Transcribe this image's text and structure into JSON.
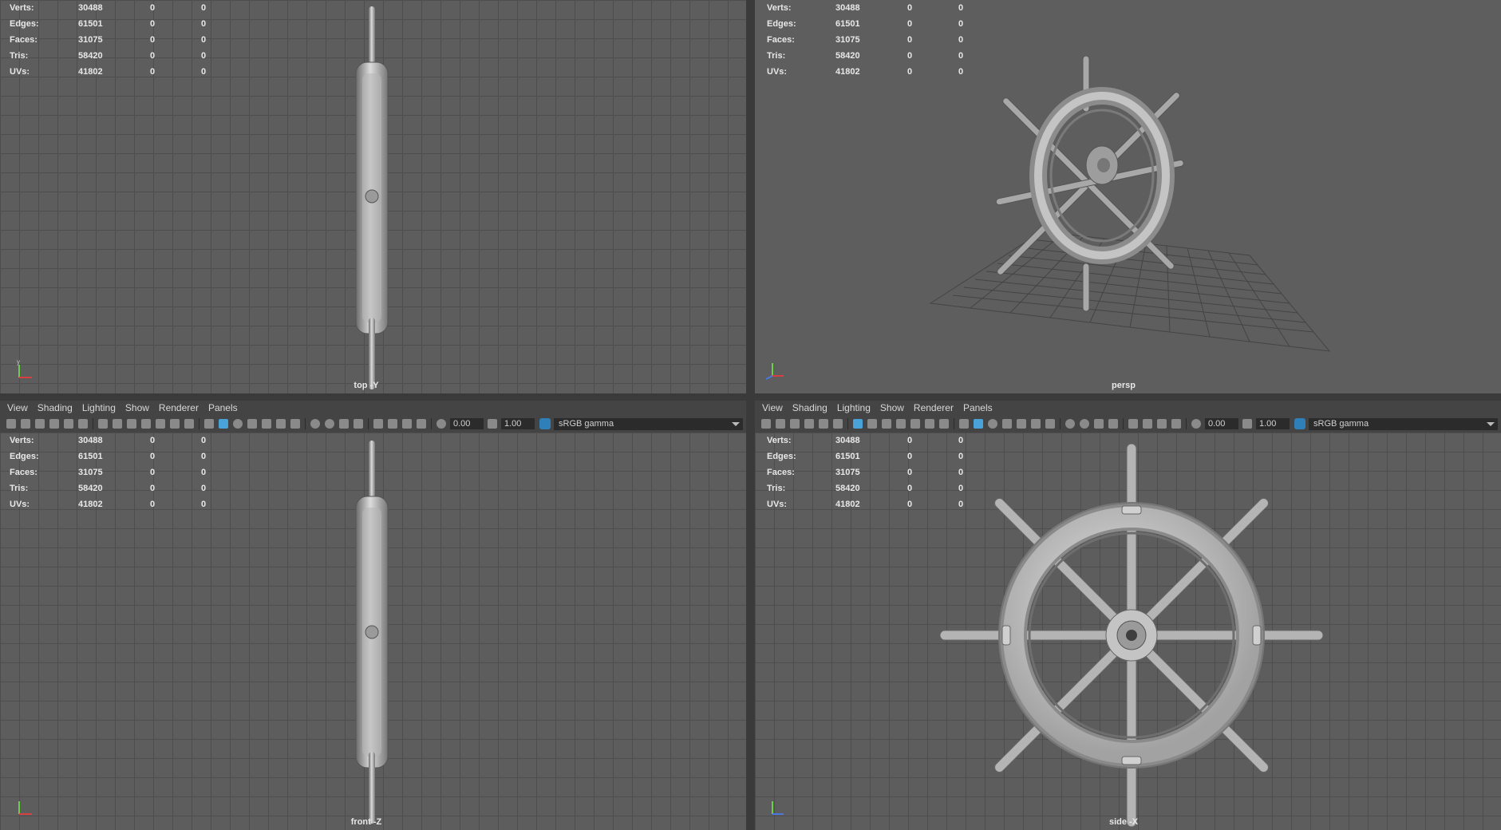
{
  "hud": {
    "rows": [
      {
        "label": "Verts:",
        "value": "30488",
        "a": "0",
        "b": "0"
      },
      {
        "label": "Edges:",
        "value": "61501",
        "a": "0",
        "b": "0"
      },
      {
        "label": "Faces:",
        "value": "31075",
        "a": "0",
        "b": "0"
      },
      {
        "label": "Tris:",
        "value": "58420",
        "a": "0",
        "b": "0"
      },
      {
        "label": "UVs:",
        "value": "41802",
        "a": "0",
        "b": "0"
      }
    ]
  },
  "viewports": {
    "top": {
      "camera": "top -Y"
    },
    "persp": {
      "camera": "persp"
    },
    "front": {
      "camera": "front -Z"
    },
    "side": {
      "camera": "side -X"
    }
  },
  "menu": [
    "View",
    "Shading",
    "Lighting",
    "Show",
    "Renderer",
    "Panels"
  ],
  "toolbar": {
    "exposure": "0.00",
    "gamma": "1.00",
    "colorspace": "sRGB gamma"
  },
  "axis_labels": {
    "y": "y",
    "x": "x",
    "z": "z"
  },
  "colors": {
    "viewport_bg": "#5d5d5d",
    "grid": "#4e4e4e",
    "panel": "#444444",
    "axis_x": "#d84040",
    "axis_y": "#6ccf48",
    "axis_z": "#4a78e0"
  }
}
